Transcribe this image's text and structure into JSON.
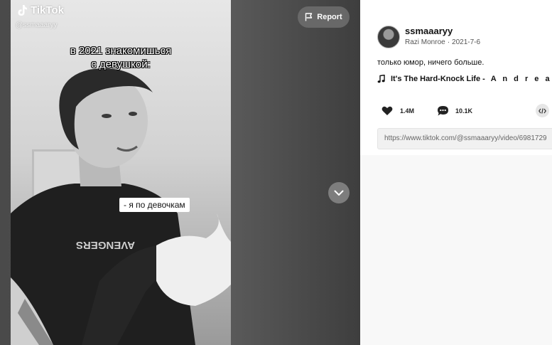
{
  "brand": {
    "name": "TikTok",
    "handle": "@ssmaaaryy"
  },
  "video": {
    "caption_top": "в 2021 знакомишься\nс девушкой:",
    "caption_mid": "- я по девочкам",
    "shirt_text": "AVENGERS"
  },
  "player": {
    "report_label": "Report"
  },
  "post": {
    "username": "ssmaaaryy",
    "author_name": "Razi Monroe",
    "date": "2021-7-6",
    "description": "только юмор, ничего больше.",
    "music_title": "It's The Hard-Knock Life -",
    "music_artist": "A n d r e a",
    "likes": "1.4M",
    "comments": "10.1K",
    "link": "https://www.tiktok.com/@ssmaaaryy/video/6981729"
  },
  "icons": {
    "report": "flag-icon",
    "nav": "chevron-down-icon",
    "music": "music-note-icon",
    "likes": "heart-icon",
    "comments": "comment-icon",
    "embed": "code-icon"
  }
}
